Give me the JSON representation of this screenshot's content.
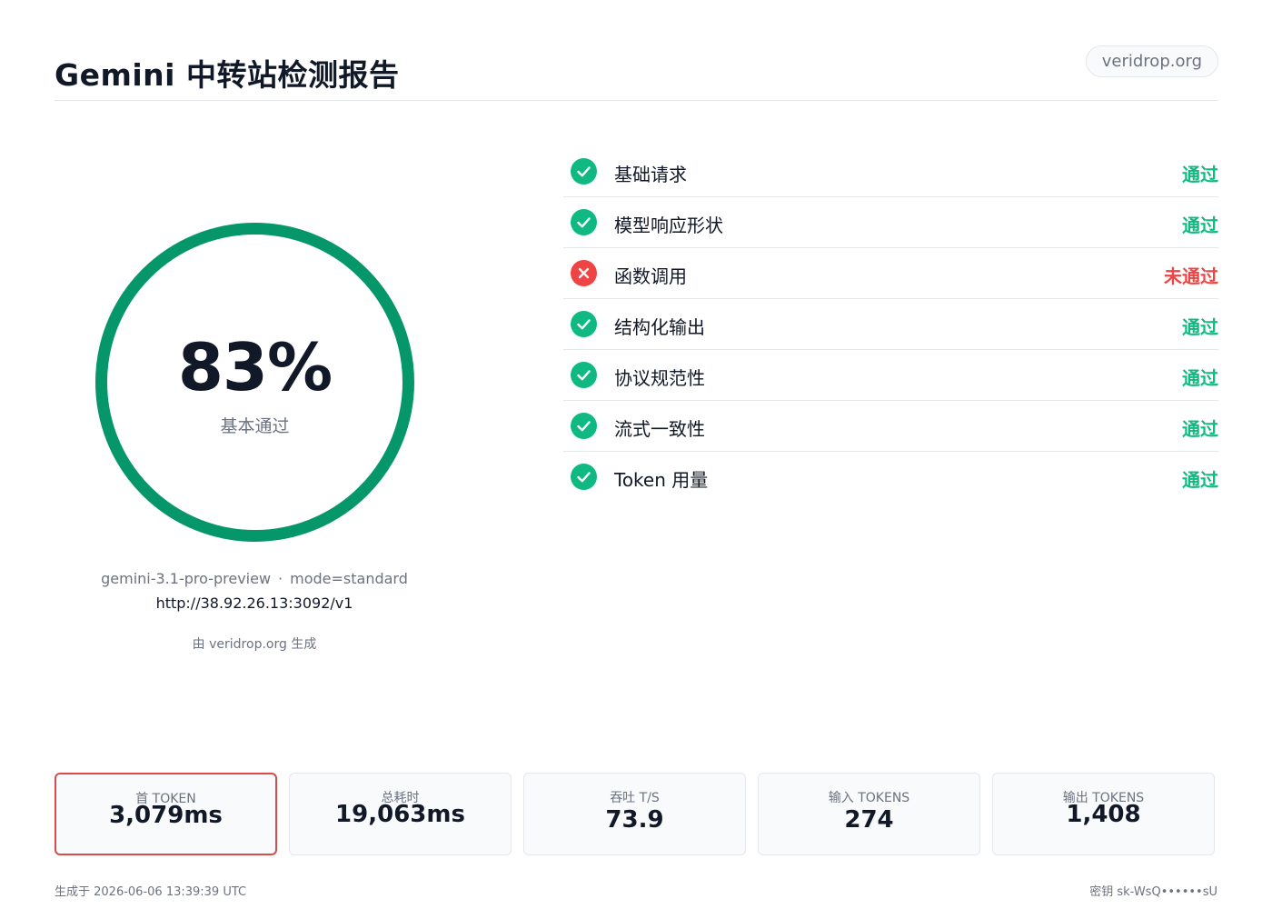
{
  "header": {
    "title": "Gemini 中转站检测报告",
    "site_badge": "veridrop.org"
  },
  "score": {
    "value": "83%",
    "fraction": 0.83,
    "label": "基本通过",
    "ring_color": "#059669"
  },
  "meta": {
    "model": "gemini-3.1-pro-preview",
    "separator": "·",
    "mode": "mode=standard",
    "endpoint": "http://38.92.26.13:3092/v1",
    "generated_by": "由 veridrop.org 生成"
  },
  "checks": [
    {
      "name": "基础请求",
      "status": "通过",
      "passed": true
    },
    {
      "name": "模型响应形状",
      "status": "通过",
      "passed": true
    },
    {
      "name": "函数调用",
      "status": "未通过",
      "passed": false
    },
    {
      "name": "结构化输出",
      "status": "通过",
      "passed": true
    },
    {
      "name": "协议规范性",
      "status": "通过",
      "passed": true
    },
    {
      "name": "流式一致性",
      "status": "通过",
      "passed": true
    },
    {
      "name": "Token 用量",
      "status": "通过",
      "passed": true
    }
  ],
  "metrics": [
    {
      "label": "首 TOKEN",
      "value": "3,079ms"
    },
    {
      "label": "总耗时",
      "value": "19,063ms"
    },
    {
      "label": "吞吐 T/S",
      "value": "73.9"
    },
    {
      "label": "输入 TOKENS",
      "value": "274"
    },
    {
      "label": "输出 TOKENS",
      "value": "1,408"
    }
  ],
  "footer": {
    "generated_at": "生成于 2026-06-06 13:39:39 UTC",
    "key": "密钥 sk-WsQ••••••sU"
  },
  "colors": {
    "pass": "#10b981",
    "fail": "#ef4444",
    "highlight_border": "#dc4a4a"
  },
  "icons": {
    "pass": "check-circle-icon",
    "fail": "x-circle-icon"
  }
}
